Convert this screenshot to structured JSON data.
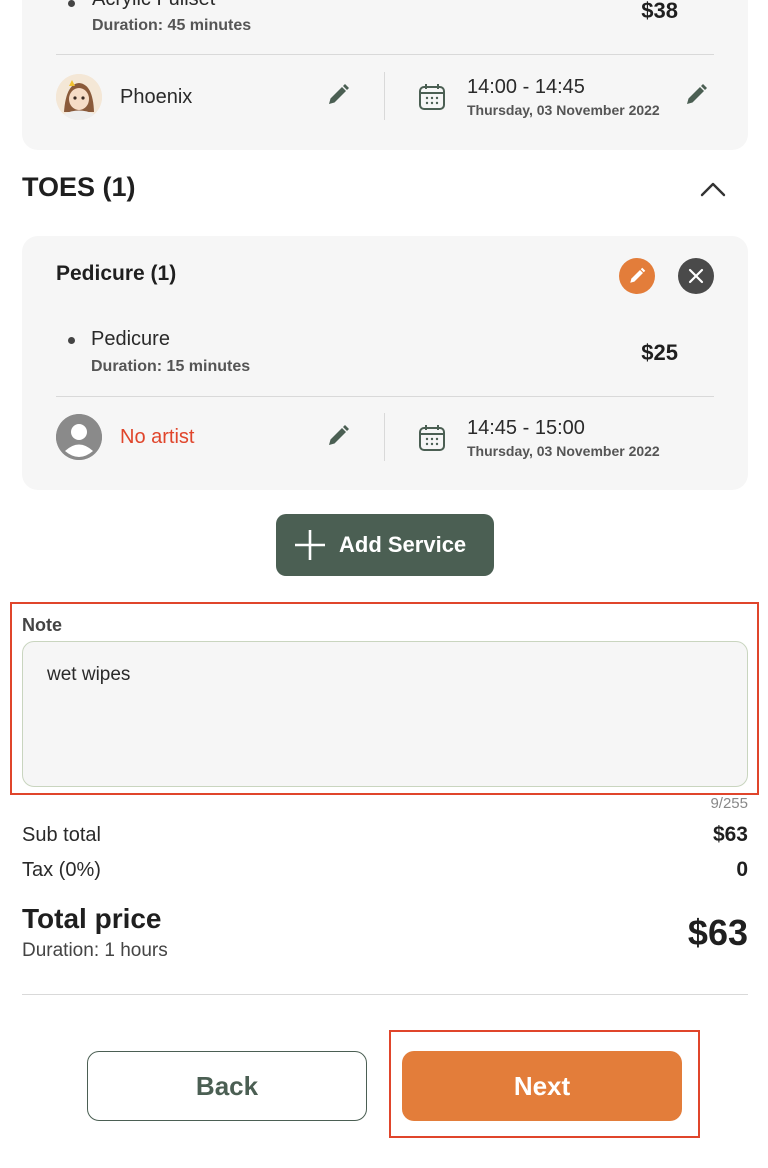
{
  "nails_card": {
    "service_name": "Acrylic Fullset",
    "duration": "Duration: 45 minutes",
    "price": "$38",
    "artist": "Phoenix",
    "time": "14:00 - 14:45",
    "date": "Thursday, 03 November 2022"
  },
  "toes_section": {
    "title": "TOES (1)",
    "group_title": "Pedicure (1)",
    "service_name": "Pedicure",
    "duration": "Duration: 15 minutes",
    "price": "$25",
    "artist": "No artist",
    "time": "14:45 - 15:00",
    "date": "Thursday, 03 November 2022"
  },
  "add_service_label": "Add Service",
  "note": {
    "label": "Note",
    "value": "wet wipes",
    "counter": "9/255"
  },
  "summary": {
    "subtotal_label": "Sub total",
    "subtotal_value": "$63",
    "tax_label": "Tax (0%)",
    "tax_value": "0",
    "total_label": "Total price",
    "total_duration": "Duration: 1 hours",
    "total_value": "$63"
  },
  "actions": {
    "back_label": "Back",
    "next_label": "Next"
  },
  "colors": {
    "accent": "#e37d3a",
    "primary": "#4b5f53",
    "error": "#e0452b"
  }
}
